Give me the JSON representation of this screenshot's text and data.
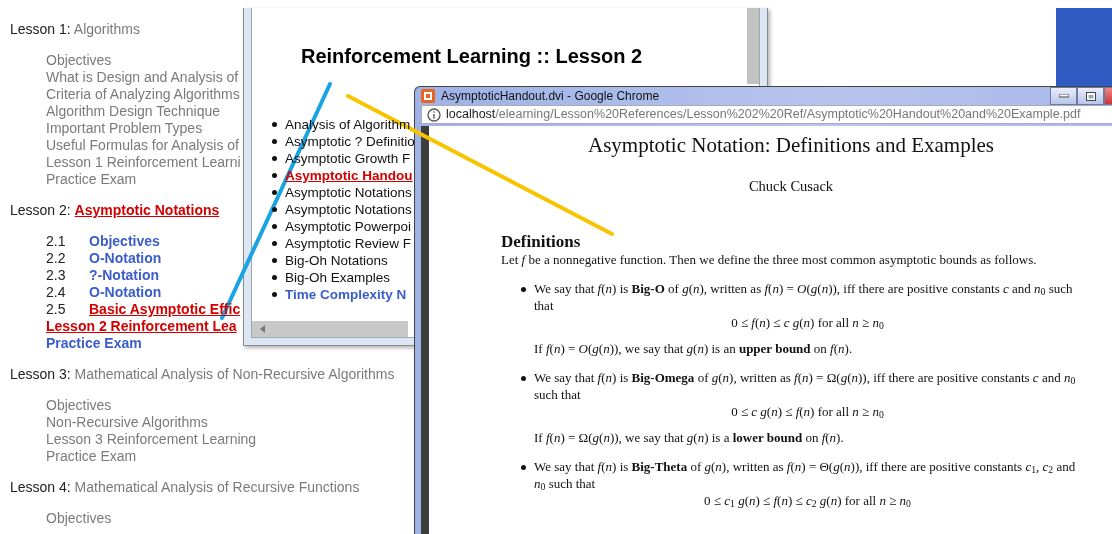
{
  "lessons": [
    {
      "label": "Lesson 1:",
      "title": {
        "text": "Algorithms",
        "kind": "plain"
      },
      "items": [
        {
          "text": "Objectives",
          "kind": "plain"
        },
        {
          "text": "What is Design and Analysis of",
          "kind": "plain"
        },
        {
          "text": "Criteria of Analyzing Algorithms",
          "kind": "plain"
        },
        {
          "text": "Algorithm Design Technique",
          "kind": "plain"
        },
        {
          "text": "Important Problem Types",
          "kind": "plain"
        },
        {
          "text": "Useful Formulas for Analysis of",
          "kind": "plain"
        },
        {
          "text": "Lesson 1 Reinforcement Learni",
          "kind": "plain"
        },
        {
          "text": "Practice Exam",
          "kind": "plain"
        }
      ]
    },
    {
      "label": "Lesson 2:",
      "title": {
        "text": "Asymptotic Notations",
        "kind": "visited"
      },
      "items": [
        {
          "number": "2.1",
          "text": "Objectives",
          "kind": "link"
        },
        {
          "number": "2.2",
          "text": "O-Notation",
          "kind": "link"
        },
        {
          "number": "2.3",
          "text": "?-Notation",
          "kind": "link"
        },
        {
          "number": "2.4",
          "text": "O-Notation",
          "kind": "link"
        },
        {
          "number": "2.5",
          "text": "Basic Asymptotic Effic",
          "kind": "visited"
        },
        {
          "text": "Lesson 2 Reinforcement Lea",
          "kind": "visited"
        },
        {
          "text": "Practice Exam",
          "kind": "link"
        }
      ]
    },
    {
      "label": "Lesson 3:",
      "title": {
        "text": "Mathematical Analysis of Non-Recursive Algorithms",
        "kind": "plain"
      },
      "items": [
        {
          "text": "Objectives",
          "kind": "plain"
        },
        {
          "text": "Non-Recursive Algorithms",
          "kind": "plain"
        },
        {
          "text": "Lesson 3 Reinforcement Learning",
          "kind": "plain"
        },
        {
          "text": "Practice Exam",
          "kind": "plain"
        }
      ]
    },
    {
      "label": "Lesson 4:",
      "title": {
        "text": "Mathematical Analysis of Recursive Functions",
        "kind": "plain"
      },
      "items": [
        {
          "text": "Objectives",
          "kind": "plain"
        }
      ]
    }
  ],
  "popup": {
    "heading": "Reinforcement Learning :: Lesson 2",
    "items": [
      {
        "text": "Analysis of Algorithm",
        "kind": "normal"
      },
      {
        "text": "Asymptotic ? Definitio",
        "kind": "normal"
      },
      {
        "text": "Asymptotic Growth F",
        "kind": "normal"
      },
      {
        "text": "Asymptotic Handou",
        "kind": "visited"
      },
      {
        "text": "Asymptotic Notations",
        "kind": "normal"
      },
      {
        "text": "Asymptotic Notations",
        "kind": "normal"
      },
      {
        "text": "Asymptotic Powerpoi",
        "kind": "normal"
      },
      {
        "text": "Asymptotic Review F",
        "kind": "normal"
      },
      {
        "text": "Big-Oh Notations",
        "kind": "normal"
      },
      {
        "text": "Big-Oh Examples",
        "kind": "normal"
      },
      {
        "text": "Time Complexity N",
        "kind": "link"
      }
    ]
  },
  "browser": {
    "title": "AsymptoticHandout.dvi - Google Chrome",
    "url_host": "localhost",
    "url_path": "/elearning/Lesson%20References/Lesson%202%20Ref/Asymptotic%20Handout%20and%20Example.pdf",
    "document": {
      "title": "Asymptotic Notation: Definitions and Examples",
      "author": "Chuck Cusack",
      "section": "Definitions",
      "intro": "Let *f* be a nonnegative function. Then we define the three most common asymptotic bounds as follows.",
      "bullets": [
        {
          "text": "We say that *f*(*n*) is **Big-O** of *g*(*n*), written as *f*(*n*) = *O*(*g*(*n*)), iff there are positive constants *c* and *n*$_{0}$ such that",
          "formula": "0 ≤ *f*(*n*) ≤ *c g*(*n*) for all *n* ≥ *n*$_{0}$",
          "note": "If *f*(*n*) = *O*(*g*(*n*)), we say that *g*(*n*) is an **upper bound** on *f*(*n*)."
        },
        {
          "text": "We say that *f*(*n*) is **Big-Omega** of *g*(*n*), written as *f*(*n*) = Ω(*g*(*n*)), iff there are positive constants *c* and *n*$_{0}$ such that",
          "formula": "0 ≤ *c g*(*n*) ≤ *f*(*n*) for all *n* ≥ *n*$_{0}$",
          "note": "If *f*(*n*) = Ω(*g*(*n*)), we say that *g*(*n*) is a **lower bound** on *f*(*n*)."
        },
        {
          "text": "We say that *f*(*n*) is **Big-Theta** of *g*(*n*), written as *f*(*n*) = Θ(*g*(*n*)), iff there are positive constants *c*$_{1}$, *c*$_{2}$ and *n*$_{0}$ such that",
          "formula": "0 ≤ *c*$_{1}$ *g*(*n*) ≤ *f*(*n*) ≤ *c*$_{2}$ *g*(*n*) for all *n* ≥ *n*$_{0}$"
        }
      ]
    }
  }
}
